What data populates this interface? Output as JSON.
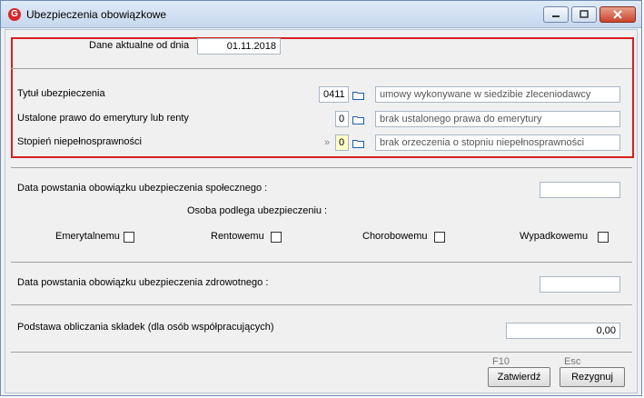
{
  "window": {
    "title": "Ubezpieczenia obowiązkowe",
    "app_icon_letter": "G"
  },
  "current_data": {
    "label": "Dane aktualne od dnia",
    "value": "01.11.2018"
  },
  "insurance_title": {
    "label": "Tytuł ubezpieczenia",
    "code": "0411",
    "description": "umowy wykonywane w siedzibie zleceniodawcy"
  },
  "pension_right": {
    "label": "Ustalone prawo do emerytury lub renty",
    "code": "0",
    "description": "brak ustalonego prawa do emerytury"
  },
  "disability": {
    "label": "Stopień niepełnosprawności",
    "marker": "»",
    "code": "0",
    "description": "brak orzeczenia o stopniu niepełnosprawności"
  },
  "social_insurance": {
    "date_label": "Data powstania obowiązku ubezpieczenia społecznego :",
    "date_value": "",
    "subject_label": "Osoba podlega ubezpieczeniu :",
    "checkboxes": [
      {
        "label": "Emerytalnemu",
        "checked": false
      },
      {
        "label": "Rentowemu",
        "checked": false
      },
      {
        "label": "Chorobowemu",
        "checked": false
      },
      {
        "label": "Wypadkowemu",
        "checked": false
      }
    ]
  },
  "health_insurance": {
    "date_label": "Data powstania obowiązku ubezpieczenia zdrowotnego :",
    "date_value": ""
  },
  "contribution_base": {
    "label": "Podstawa obliczania składek (dla osób współpracujących)",
    "value": "0,00"
  },
  "buttons": {
    "confirm_key": "F10",
    "confirm_label": "Zatwierdź",
    "cancel_key": "Esc",
    "cancel_label": "Rezygnuj"
  },
  "colors": {
    "highlight_border": "#d62020",
    "code_highlight": "#ffffc8"
  }
}
